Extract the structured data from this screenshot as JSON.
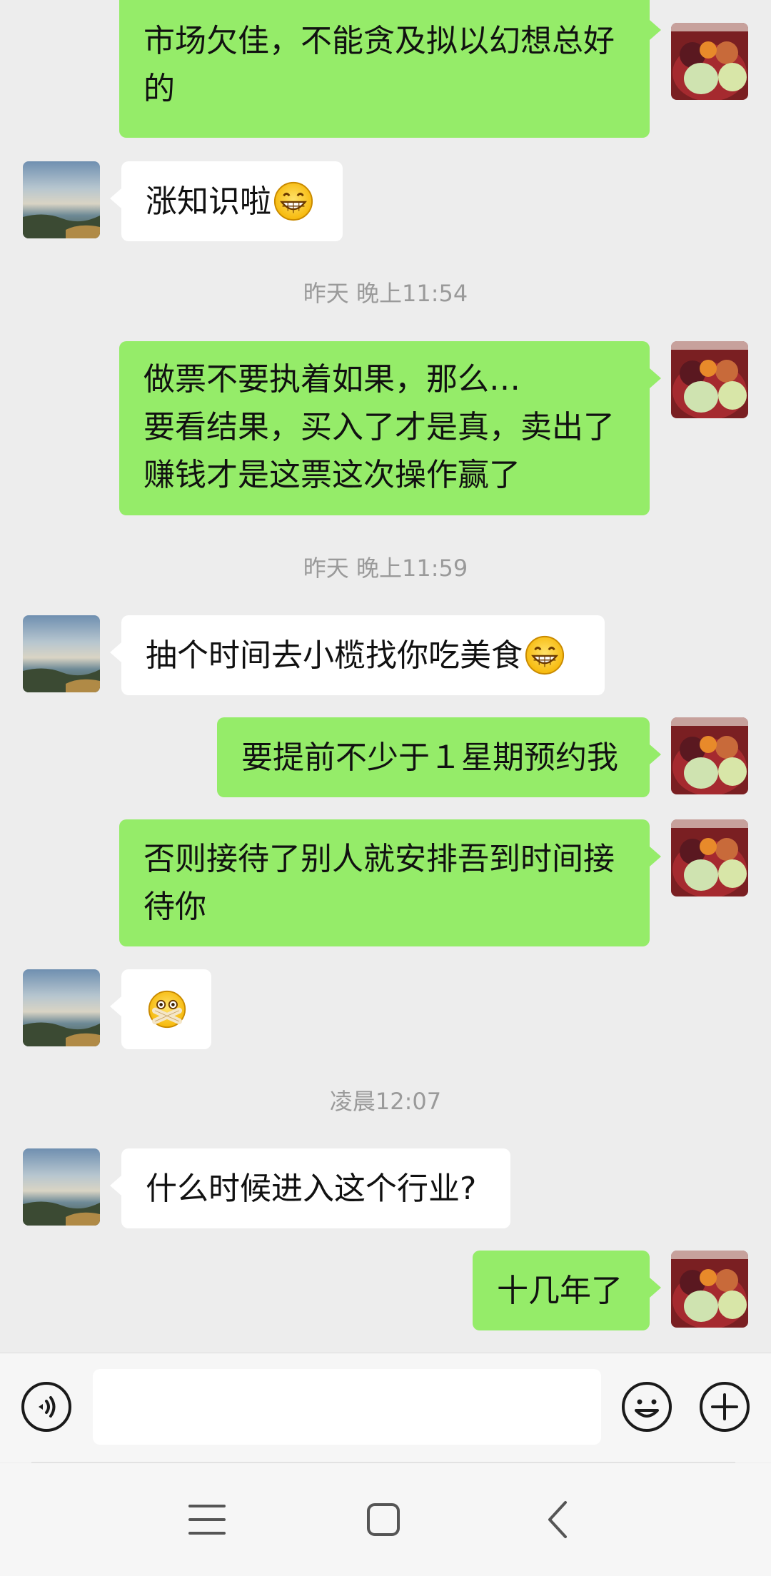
{
  "messages": [
    {
      "side": "out",
      "lines": "市场欠佳，不能贪及拟以幻想总好\n的"
    },
    {
      "side": "in",
      "text": "涨知识啦",
      "emoji": "grin-emoji"
    },
    {
      "side": "time",
      "text": "昨天 晚上11:54"
    },
    {
      "side": "out",
      "lines": "做票不要执着如果，那么…\n要看结果，买入了才是真，卖出了\n赚钱才是这票这次操作赢了"
    },
    {
      "side": "time",
      "text": "昨天 晚上11:59"
    },
    {
      "side": "in",
      "text": "抽个时间去小榄找你吃美食",
      "emoji": "grin-emoji"
    },
    {
      "side": "out",
      "text": "要提前不少于１星期预约我"
    },
    {
      "side": "out",
      "lines": "否则接待了别人就安排吾到时间接\n待你"
    },
    {
      "side": "in",
      "emoji": "zipped-mouth-emoji"
    },
    {
      "side": "time",
      "text": "凌晨12:07"
    },
    {
      "side": "in",
      "text": "什么时候进入这个行业?"
    },
    {
      "side": "out",
      "text": "十几年了"
    }
  ],
  "input_bar": {
    "voice_icon": "voice-icon",
    "input_value": "",
    "emoji_icon": "emoji-icon",
    "more_icon": "plus-icon"
  },
  "nav_bar": {
    "menu_icon": "menu-icon",
    "home_icon": "home-icon",
    "back_icon": "back-icon"
  },
  "colors": {
    "background": "#ededed",
    "outgoing_bubble": "#95ec69",
    "incoming_bubble": "#ffffff",
    "timestamp": "#9a9a9a"
  }
}
